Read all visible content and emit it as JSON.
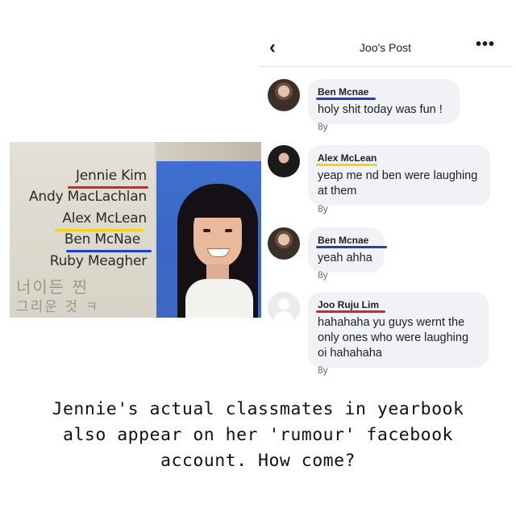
{
  "colors": {
    "red_underline": "#d8232a",
    "yellow_underline": "#f2d21b",
    "blue_underline": "#1f3fc8",
    "bubble_bg": "#f0f2f5",
    "muted_text": "#65676b"
  },
  "yearbook": {
    "names": [
      "Jennie Kim",
      "Andy MacLachlan",
      "Alex McLean",
      "Ben McNae",
      "Ruby Meagher"
    ],
    "handwriting": [
      "너이든 찐",
      "그리운 것 ㅋ"
    ]
  },
  "post": {
    "header": {
      "back_icon": "chevron-left-icon",
      "title": "Joo's Post",
      "more_icon": "more-horizontal-icon",
      "more_glyph": "•••"
    },
    "comments": [
      {
        "author": "Ben Mcnae",
        "text": "holy shit today was fun !",
        "time": "8y",
        "underline": "blue"
      },
      {
        "author": "Alex McLean",
        "text": "yeap me nd ben were laughing at them",
        "time": "8y",
        "underline": "yellow"
      },
      {
        "author": "Ben Mcnae",
        "text": "yeah ahha",
        "time": "8y",
        "underline": "blue"
      },
      {
        "author": "Joo Ruju Lim",
        "text": "hahahaha yu guys wernt the only ones who were laughing oi hahahaha",
        "time": "8y",
        "underline": "red"
      }
    ]
  },
  "caption": "Jennie's actual classmates in yearbook also appear on her 'rumour' facebook account. How come?"
}
